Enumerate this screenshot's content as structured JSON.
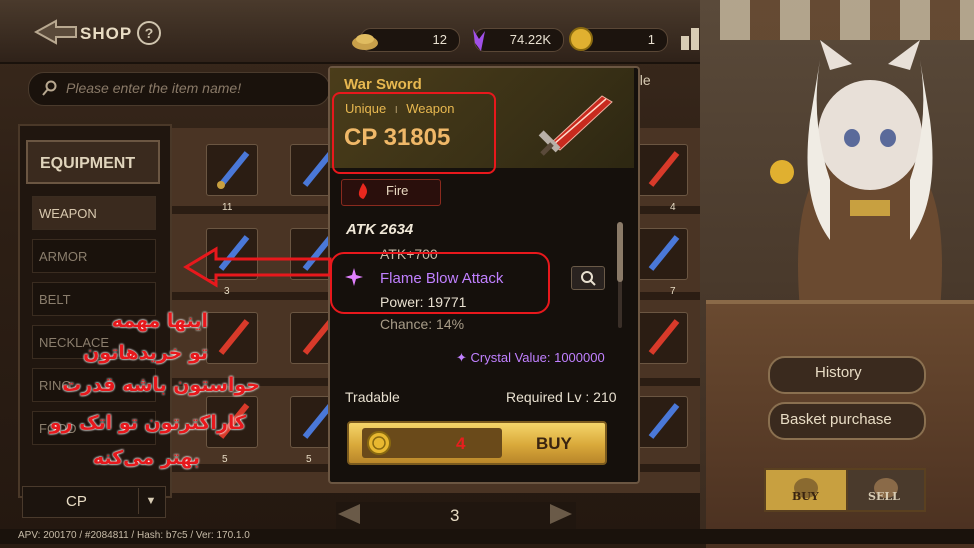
{
  "topbar": {
    "shop_label": "SHOP",
    "help_symbol": "?",
    "resources": {
      "wood": "12",
      "crystal": "74.22K",
      "gold": "1"
    },
    "icons": [
      "ranking-icon",
      "scroll-icon",
      "briefcase-icon",
      "anvil-icon",
      "mail-icon",
      "menu-icon"
    ]
  },
  "search": {
    "placeholder": "Please enter the item name!",
    "fragment_right": "ole"
  },
  "categories": {
    "items": [
      "EQUIPMENT",
      "WEAPON",
      "ARMOR",
      "BELT",
      "NECKLACE",
      "RING",
      "FOOD"
    ],
    "sort_value": "CP",
    "sort_arrow": "▼"
  },
  "grid": {
    "counts": [
      "11",
      "4",
      "3",
      "7",
      "5",
      "5"
    ]
  },
  "popup": {
    "title": "War Sword",
    "rarity": "Unique",
    "separator": "I",
    "type": "Weapon",
    "cp_text": "CP 31805",
    "element": "Fire",
    "atk_text": "ATK  2634",
    "atk_bonus": "ATK+700",
    "skill_name": "Flame Blow Attack",
    "skill_power": "Power: 19771",
    "skill_chance": "Chance: 14%",
    "crystal_value": "Crystal Value: 1000000",
    "tradable": "Tradable",
    "required_level": "Required Lv : 210",
    "price": "4",
    "buy_label": "BUY"
  },
  "pager": {
    "page": "3"
  },
  "side": {
    "history_label": "History",
    "basket_label": "Basket purchase",
    "buy_tab": "BUY",
    "sell_tab": "SELL"
  },
  "footer": {
    "text": "APV: 200170 / #2084811 / Hash: b7c5 / Ver: 170.1.0"
  },
  "annotation": {
    "line1": "اینها مهمه",
    "line2": "تو خریدهاتون",
    "line3": "حواستون باشه قدرت",
    "line4": "کاراکترتون تو اتک رو",
    "line5": "بهتر می‌کنه"
  },
  "colors": {
    "annotation_red": "#e8181c",
    "rarity_gold": "#e8b850",
    "skill_purple": "#c080ff",
    "buy_gold": "#f5d56a"
  }
}
